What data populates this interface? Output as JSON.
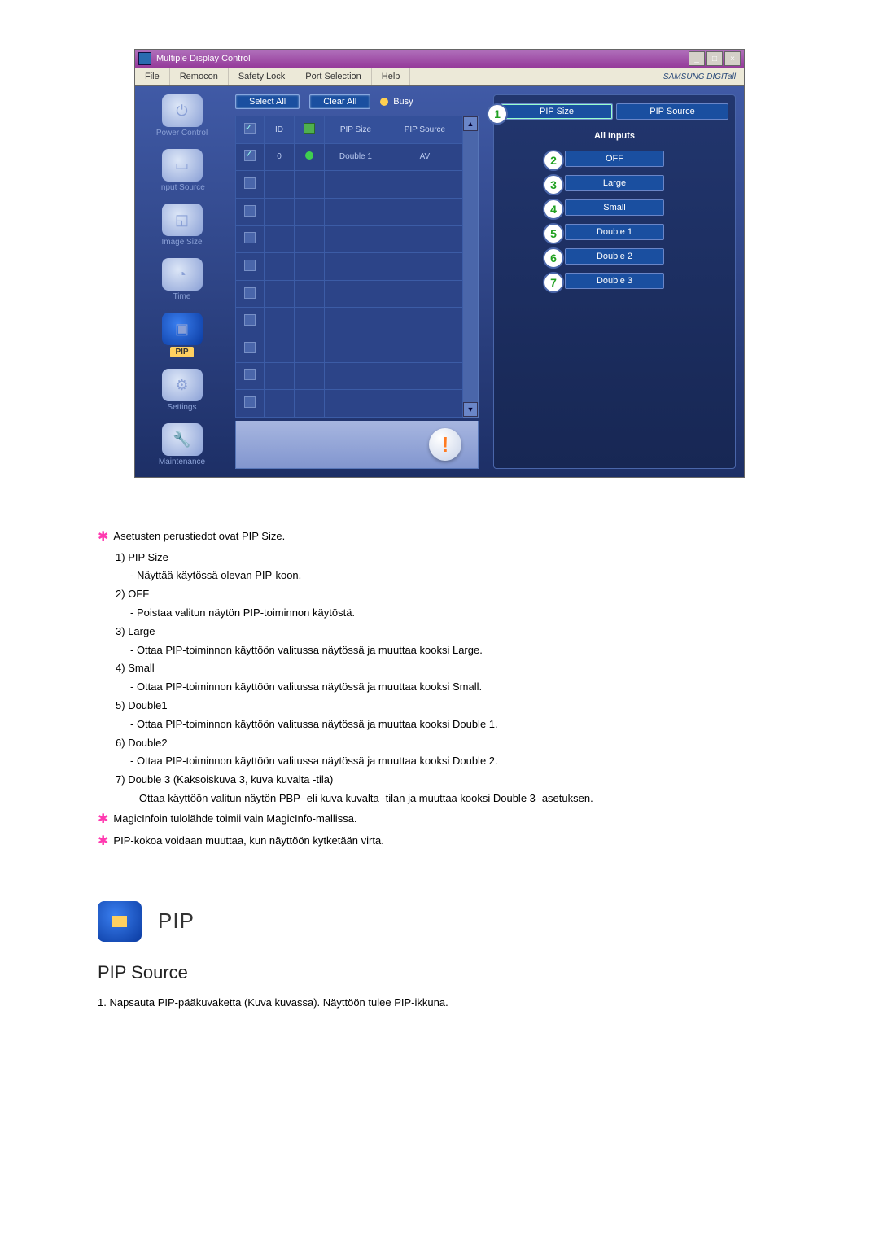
{
  "window": {
    "title": "Multiple Display Control",
    "menu": [
      "File",
      "Remocon",
      "Safety Lock",
      "Port Selection",
      "Help"
    ],
    "brand": "SAMSUNG DIGITall"
  },
  "sidebar": {
    "items": [
      {
        "label": "Power Control"
      },
      {
        "label": "Input Source"
      },
      {
        "label": "Image Size"
      },
      {
        "label": "Time"
      },
      {
        "label": "PIP"
      },
      {
        "label": "Settings"
      },
      {
        "label": "Maintenance"
      }
    ]
  },
  "toolbar": {
    "select_all": "Select All",
    "clear_all": "Clear All",
    "busy": "Busy"
  },
  "grid": {
    "headers": {
      "id": "ID",
      "pip_size": "PIP Size",
      "pip_source": "PIP Source"
    },
    "rows": [
      {
        "checked": true,
        "id": "0",
        "status": "green",
        "pip_size": "Double 1",
        "pip_source": "AV"
      },
      {
        "checked": false
      },
      {
        "checked": false
      },
      {
        "checked": false
      },
      {
        "checked": false
      },
      {
        "checked": false
      },
      {
        "checked": false
      },
      {
        "checked": false
      },
      {
        "checked": false
      },
      {
        "checked": false
      }
    ]
  },
  "right_panel": {
    "tab_size": "PIP Size",
    "tab_source": "PIP Source",
    "all_inputs": "All Inputs",
    "options": [
      {
        "n": "2",
        "label": "OFF"
      },
      {
        "n": "3",
        "label": "Large"
      },
      {
        "n": "4",
        "label": "Small"
      },
      {
        "n": "5",
        "label": "Double 1"
      },
      {
        "n": "6",
        "label": "Double 2"
      },
      {
        "n": "7",
        "label": "Double 3"
      }
    ],
    "callout_one": "1"
  },
  "text": {
    "intro": "Asetusten perustiedot ovat PIP Size.",
    "items": [
      {
        "num": "1)",
        "title": "PIP Size",
        "desc": "- Näyttää käytössä olevan PIP-koon."
      },
      {
        "num": "2)",
        "title": "OFF",
        "desc": "- Poistaa valitun näytön PIP-toiminnon käytöstä."
      },
      {
        "num": "3)",
        "title": "Large",
        "desc": "- Ottaa PIP-toiminnon käyttöön valitussa näytössä ja muuttaa kooksi Large."
      },
      {
        "num": "4)",
        "title": "Small",
        "desc": "- Ottaa PIP-toiminnon käyttöön valitussa näytössä ja muuttaa kooksi Small."
      },
      {
        "num": "5)",
        "title": "Double1",
        "desc": "- Ottaa PIP-toiminnon käyttöön valitussa näytössä ja muuttaa kooksi Double 1."
      },
      {
        "num": "6)",
        "title": "Double2",
        "desc": "- Ottaa PIP-toiminnon käyttöön valitussa näytössä ja muuttaa kooksi Double 2."
      },
      {
        "num": "7)",
        "title": "Double 3 (Kaksoiskuva 3, kuva kuvalta -tila)",
        "desc": "– Ottaa käyttöön valitun näytön PBP- eli kuva kuvalta -tilan ja muuttaa kooksi Double 3 -asetuksen."
      }
    ],
    "note1": "MagicInfoin tulolähde toimii vain MagicInfo-mallissa.",
    "note2": "PIP-kokoa voidaan muuttaa, kun näyttöön kytketään virta.",
    "section_label": "PIP",
    "source_title": "PIP Source",
    "source_line": "1. Napsauta PIP-pääkuvaketta (Kuva kuvassa). Näyttöön tulee PIP-ikkuna."
  }
}
